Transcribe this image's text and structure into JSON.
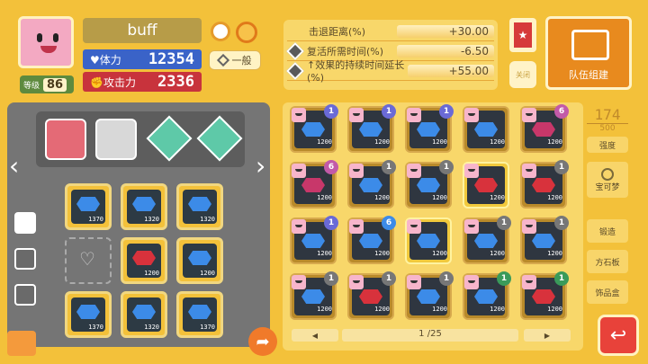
{
  "header": {
    "name": "buff",
    "level_label": "等级",
    "level": "86"
  },
  "stats": {
    "hp_label": "体力",
    "hp": "12354",
    "atk_label": "攻击力",
    "atk": "2336",
    "mode": "一般"
  },
  "buffs": [
    {
      "label": "击退距离(%)",
      "value": "+30.00"
    },
    {
      "label": "复活所需时间(%)",
      "value": "-6.50"
    },
    {
      "label": "↑效果的持续时间延长(%)",
      "value": "+55.00"
    }
  ],
  "right_top": {
    "close_label": "关闭",
    "team_label": "队伍组建"
  },
  "board": {
    "slots": [
      {
        "val": "1370",
        "gem": "blue"
      },
      {
        "val": "1320",
        "gem": "blue"
      },
      {
        "val": "1320",
        "gem": "blue"
      },
      {
        "val": "",
        "gem": "none"
      },
      {
        "val": "1200",
        "gem": "red"
      },
      {
        "val": "1200",
        "gem": "blue"
      },
      {
        "val": "1370",
        "gem": "blue"
      },
      {
        "val": "1320",
        "gem": "blue"
      },
      {
        "val": "1370",
        "gem": "blue"
      }
    ]
  },
  "inventory": {
    "counter": "174",
    "capacity": "500",
    "page": "1 /25",
    "items": [
      {
        "v": "1200",
        "g": "blue",
        "b": "1",
        "bc": "#6a6ad6"
      },
      {
        "v": "1200",
        "g": "blue",
        "b": "1",
        "bc": "#6a6ad6"
      },
      {
        "v": "1200",
        "g": "blue",
        "b": "1",
        "bc": "#6a6ad6"
      },
      {
        "v": "1200",
        "g": "blue",
        "b": "",
        "bc": ""
      },
      {
        "v": "1200",
        "g": "pink",
        "b": "6",
        "bc": "#c25aa8"
      },
      {
        "v": "1200",
        "g": "pink",
        "b": "6",
        "bc": "#c25aa8"
      },
      {
        "v": "1200",
        "g": "blue",
        "b": "1",
        "bc": "#777"
      },
      {
        "v": "1200",
        "g": "blue",
        "b": "1",
        "bc": "#777"
      },
      {
        "v": "1200",
        "g": "red",
        "b": "",
        "bc": "",
        "gold": true
      },
      {
        "v": "1200",
        "g": "red",
        "b": "1",
        "bc": "#777"
      },
      {
        "v": "1200",
        "g": "blue",
        "b": "1",
        "bc": "#6a6ad6"
      },
      {
        "v": "1200",
        "g": "blue",
        "b": "6",
        "bc": "#3c8be8"
      },
      {
        "v": "1200",
        "g": "blue",
        "b": "",
        "bc": "",
        "gold": true
      },
      {
        "v": "1200",
        "g": "blue",
        "b": "1",
        "bc": "#777"
      },
      {
        "v": "1200",
        "g": "blue",
        "b": "1",
        "bc": "#777"
      },
      {
        "v": "1200",
        "g": "blue",
        "b": "1",
        "bc": "#777"
      },
      {
        "v": "1200",
        "g": "red",
        "b": "1",
        "bc": "#777"
      },
      {
        "v": "1200",
        "g": "blue",
        "b": "1",
        "bc": "#777"
      },
      {
        "v": "1200",
        "g": "blue",
        "b": "1",
        "bc": "#3a9a5a"
      },
      {
        "v": "1200",
        "g": "red",
        "b": "1",
        "bc": "#3a9a5a"
      }
    ]
  },
  "side_buttons": {
    "strength": "强度",
    "pokemon": "宝可梦",
    "forge": "锻造",
    "stone": "方石板",
    "props": "饰品盒"
  }
}
